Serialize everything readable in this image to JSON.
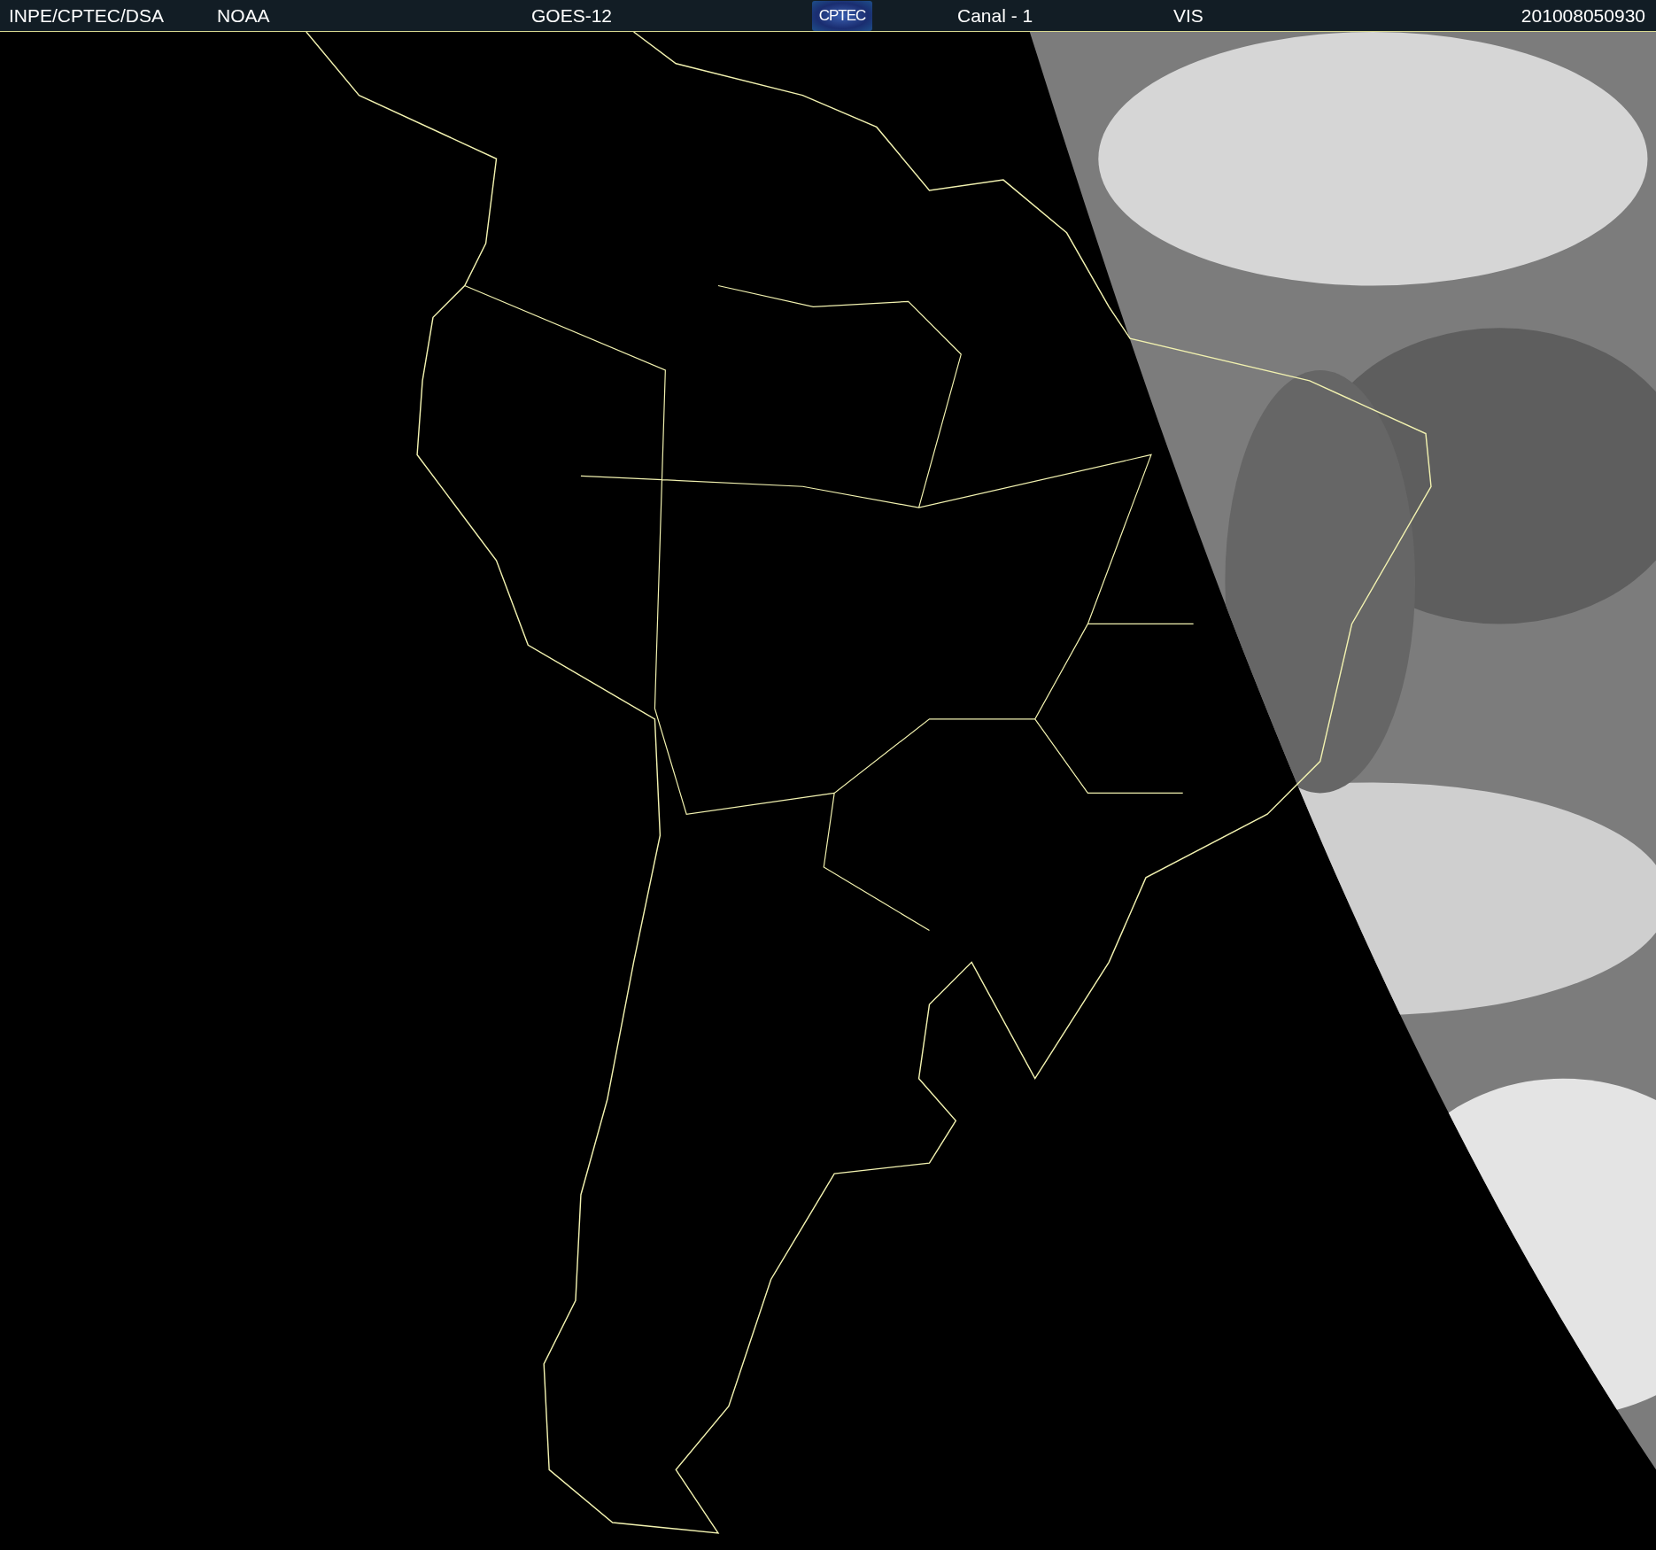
{
  "header": {
    "source": "INPE/CPTEC/DSA",
    "agency": "NOAA",
    "satellite": "GOES-12",
    "logo": "CPTEC",
    "channel": "Canal - 1",
    "band": "VIS",
    "timestamp": "201008050930"
  }
}
